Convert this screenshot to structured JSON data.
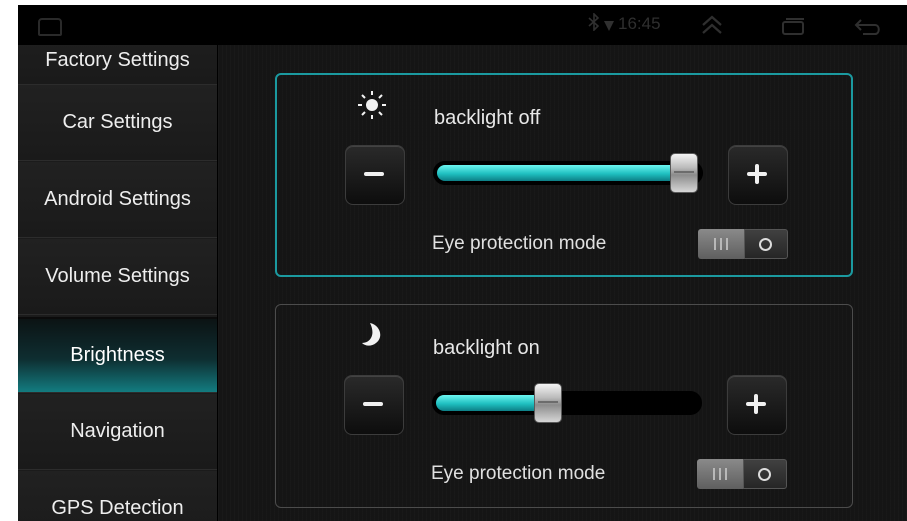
{
  "status_bar": {
    "time": "16:45",
    "icons": [
      "home-icon",
      "bluetooth-icon",
      "signal-icon",
      "expand-up-icon",
      "recent-apps-icon",
      "back-icon"
    ]
  },
  "sidebar": {
    "items": [
      {
        "label": "Factory Settings"
      },
      {
        "label": "Car Settings"
      },
      {
        "label": "Android Settings"
      },
      {
        "label": "Volume Settings"
      },
      {
        "label": "Brightness",
        "active": true
      },
      {
        "label": "Navigation"
      },
      {
        "label": "GPS Detection"
      }
    ]
  },
  "panels": [
    {
      "icon": "sun-icon",
      "label": "backlight off",
      "level": 0.97,
      "eye_label": "Eye protection mode",
      "eye_on": true
    },
    {
      "icon": "moon-icon",
      "label": "backlight on",
      "level": 0.42,
      "eye_label": "Eye protection mode",
      "eye_on": true
    }
  ],
  "colors": {
    "accent": "#1b9aa0",
    "slider_fill": "#22c5c4",
    "active_item": "#137c80"
  }
}
